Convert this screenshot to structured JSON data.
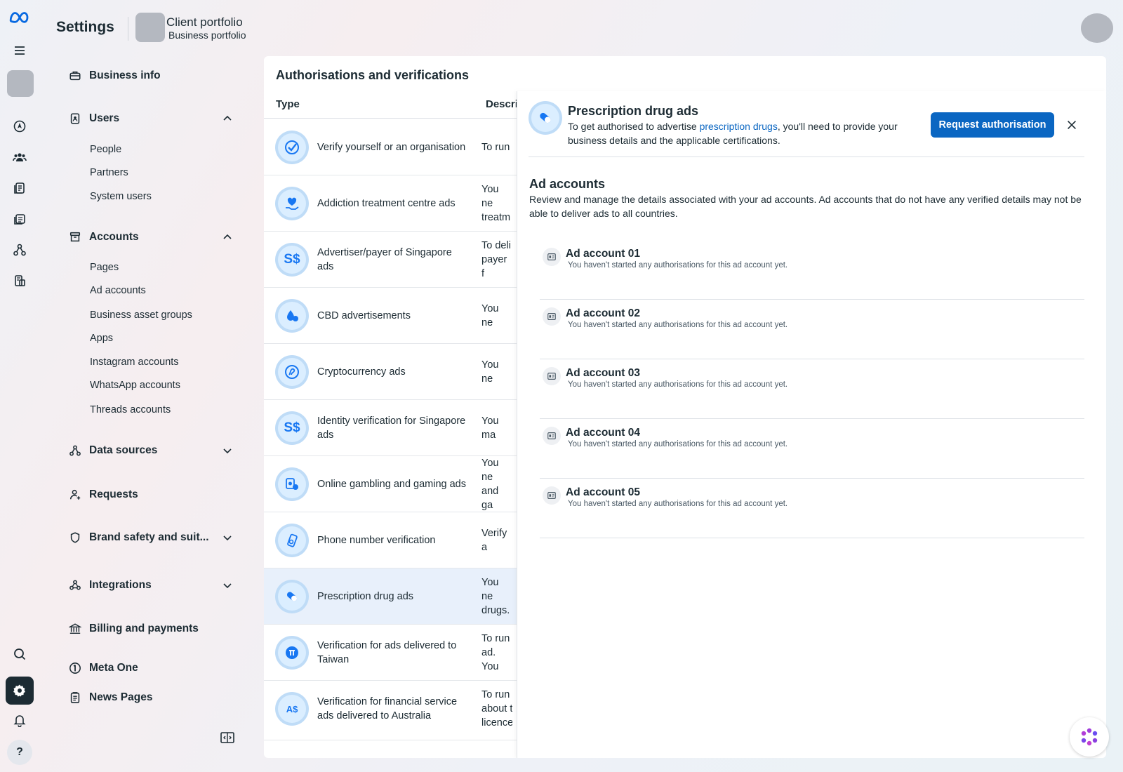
{
  "header": {
    "title": "Settings",
    "portfolio_name": "Client portfolio",
    "portfolio_type": "Business portfolio"
  },
  "sidebar": {
    "sections": [
      {
        "label": "Business info",
        "icon": "briefcase-icon"
      },
      {
        "label": "Users",
        "icon": "id-badge-icon",
        "expanded": true,
        "items": [
          "People",
          "Partners",
          "System users"
        ]
      },
      {
        "label": "Accounts",
        "icon": "archive-icon",
        "expanded": true,
        "items": [
          "Pages",
          "Ad accounts",
          "Business asset groups",
          "Apps",
          "Instagram accounts",
          "WhatsApp accounts",
          "Threads accounts"
        ]
      },
      {
        "label": "Data sources",
        "icon": "data-sources-icon",
        "expanded": false
      },
      {
        "label": "Requests",
        "icon": "person-request-icon"
      },
      {
        "label": "Brand safety and suit...",
        "icon": "shield-icon",
        "expanded": false
      },
      {
        "label": "Integrations",
        "icon": "integrations-icon",
        "expanded": false
      },
      {
        "label": "Billing and payments",
        "icon": "bank-icon"
      },
      {
        "label": "Meta One",
        "icon": "meta-one-icon"
      },
      {
        "label": "News Pages",
        "icon": "news-icon"
      }
    ]
  },
  "main": {
    "title": "Authorisations and verifications",
    "columns": [
      "Type",
      "Descri"
    ],
    "rows": [
      {
        "name": "Verify yourself or an organisation",
        "desc": "To run",
        "icon": "verify-check-icon"
      },
      {
        "name": "Addiction treatment centre ads",
        "desc": "You ne\ntreatm",
        "icon": "heart-hand-icon"
      },
      {
        "name": "Advertiser/payer of Singapore ads",
        "desc": "To deli\npayer f",
        "icon": "sgd-icon"
      },
      {
        "name": "CBD advertisements",
        "desc": "You ne",
        "icon": "cbd-drop-icon"
      },
      {
        "name": "Cryptocurrency ads",
        "desc": "You ne",
        "icon": "crypto-coin-icon"
      },
      {
        "name": "Identity verification for Singapore ads",
        "desc": "You ma",
        "icon": "sgd-icon"
      },
      {
        "name": "Online gambling and gaming ads",
        "desc": "You ne\nand ga",
        "icon": "cards-chips-icon"
      },
      {
        "name": "Phone number verification",
        "desc": "Verify a",
        "icon": "phone-icon"
      },
      {
        "name": "Prescription drug ads",
        "desc": "You ne\ndrugs.",
        "icon": "pill-icon",
        "selected": true
      },
      {
        "name": "Verification for ads delivered to Taiwan",
        "desc": "To run\nad. You",
        "icon": "twd-icon"
      },
      {
        "name": "Verification for financial service ads delivered to Australia",
        "desc": "To run\nabout t\nlicence",
        "icon": "aud-icon"
      }
    ]
  },
  "panel": {
    "title": "Prescription drug ads",
    "desc_before": "To get authorised to advertise ",
    "desc_link": "prescription drugs",
    "desc_after": ", you'll need to provide your business details and the applicable certifications.",
    "button": "Request authorisation",
    "section_title": "Ad accounts",
    "section_desc": "Review and manage the details associated with your ad accounts. Ad accounts that do not have any verified details may not be able to deliver ads to all countries.",
    "accounts": [
      {
        "name": "Ad account 01",
        "status": "You haven't started any authorisations for this ad account yet."
      },
      {
        "name": "Ad account 02",
        "status": "You haven't started any authorisations for this ad account yet."
      },
      {
        "name": "Ad account 03",
        "status": "You haven't started any authorisations for this ad account yet."
      },
      {
        "name": "Ad account 04",
        "status": "You haven't started any authorisations for this ad account yet."
      },
      {
        "name": "Ad account 05",
        "status": "You haven't started any authorisations for this ad account yet."
      }
    ]
  },
  "rail": {
    "help_label": "?"
  },
  "colors": {
    "primary": "#0a66c2",
    "meta_blue": "#0668e1",
    "selected_row": "#e8f0fb",
    "text": "#1c2b33"
  }
}
